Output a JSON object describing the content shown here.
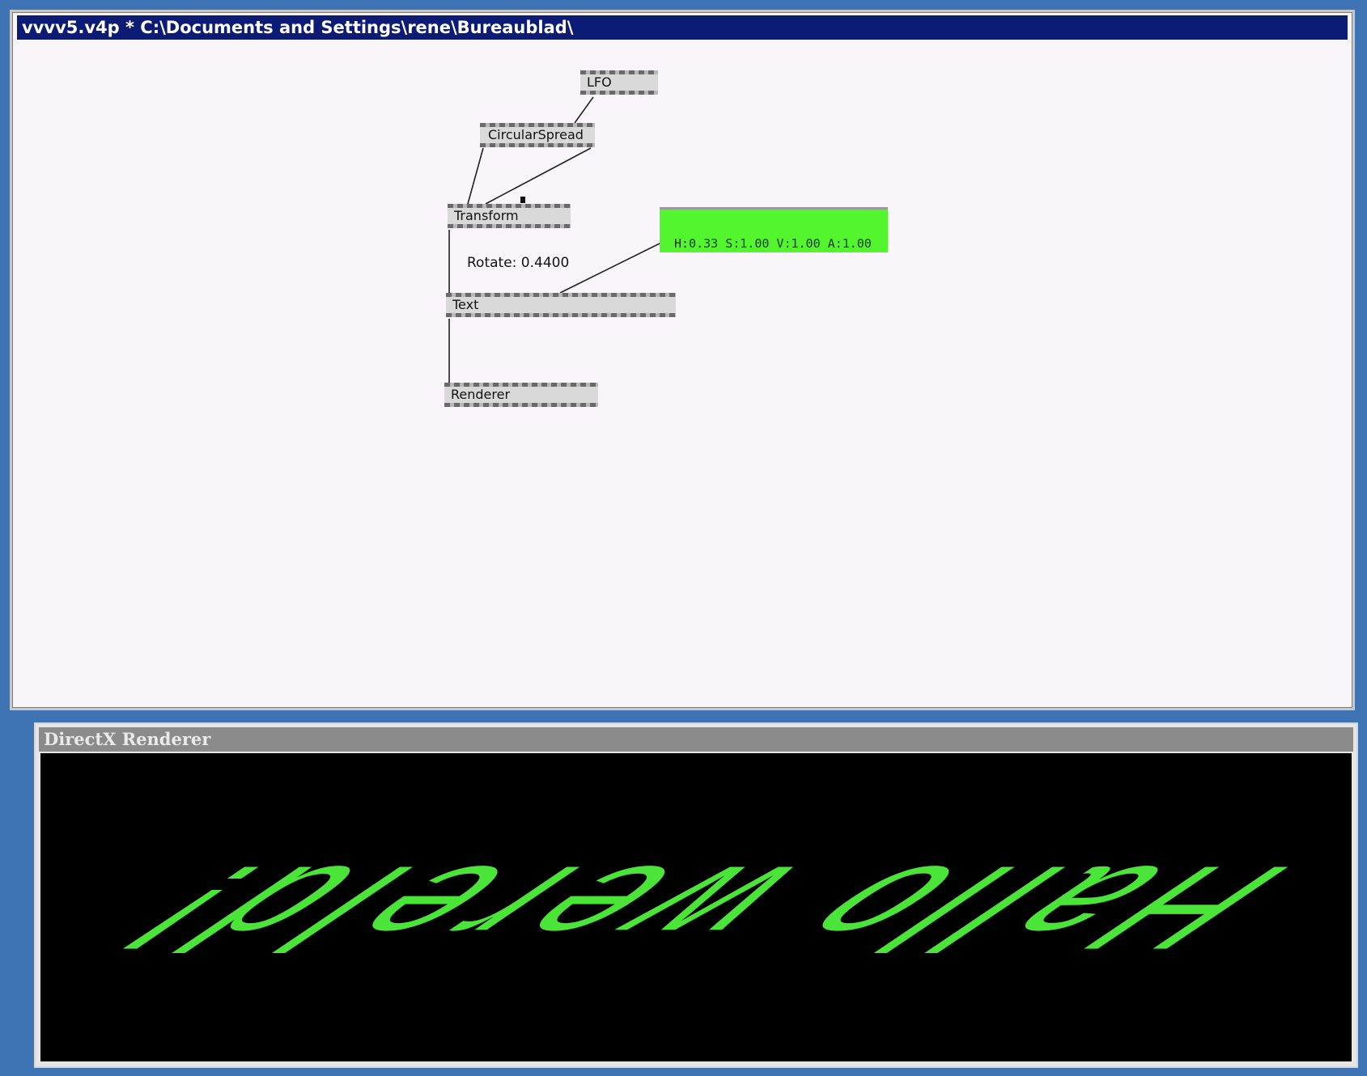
{
  "patch_window": {
    "title": "vvvv5.v4p *  C:\\Documents and Settings\\rene\\Bureaublad\\"
  },
  "nodes": {
    "lfo": "LFO",
    "circular_spread": "CircularSpread",
    "transform": "Transform",
    "text": "Text",
    "renderer": "Renderer"
  },
  "rotate_iobox": "Rotate: 0.4400",
  "color_iobox": {
    "value": "H:0.33  S:1.00  V:1.00  A:1.00",
    "color": "#52f52e"
  },
  "renderer_window": {
    "title": "DirectX Renderer",
    "rendered_text": "Hallo wereld!",
    "text_color": "#4be53a",
    "background": "#000000"
  }
}
